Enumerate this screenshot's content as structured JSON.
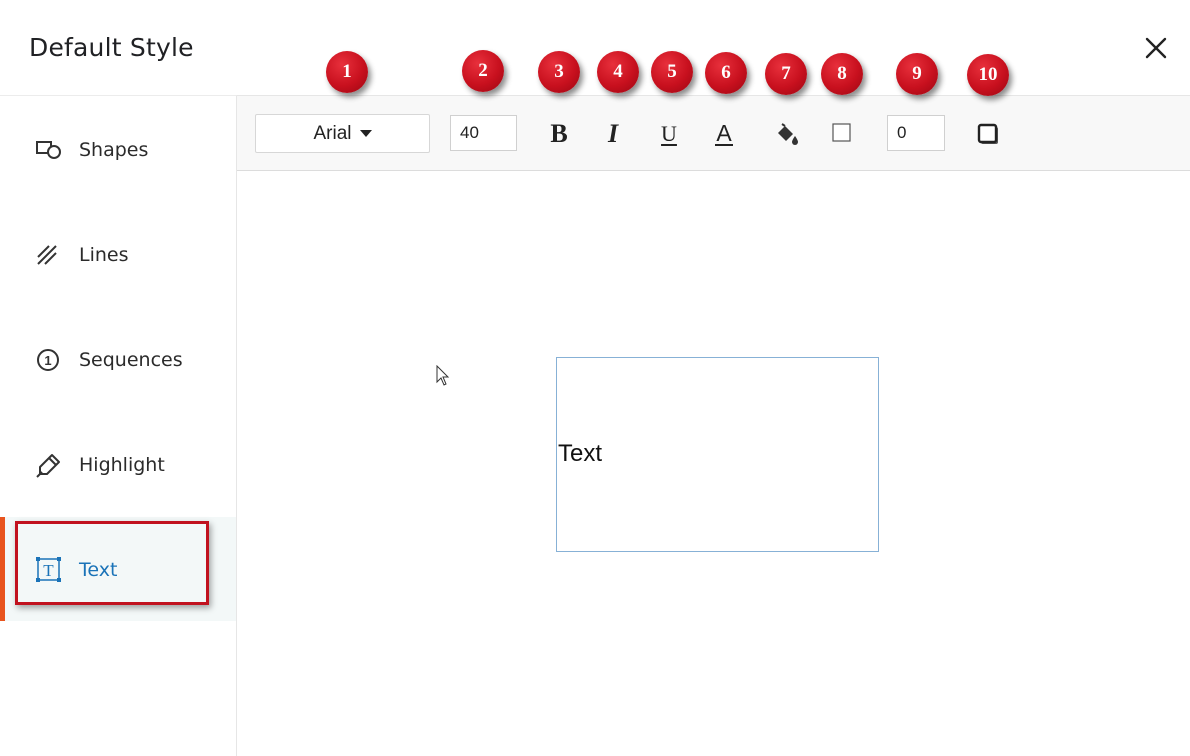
{
  "dialog": {
    "title": "Default Style",
    "close_icon": "close-icon"
  },
  "sidebar": {
    "items": [
      {
        "label": "Shapes",
        "icon": "shapes-icon",
        "active": false
      },
      {
        "label": "Lines",
        "icon": "lines-icon",
        "active": false
      },
      {
        "label": "Sequences",
        "icon": "sequence-number-icon",
        "active": false
      },
      {
        "label": "Highlight",
        "icon": "highlighter-icon",
        "active": false
      },
      {
        "label": "Text",
        "icon": "text-box-icon",
        "active": true
      }
    ]
  },
  "toolbar": {
    "font_family": "Arial",
    "font_size": "40",
    "bold_glyph": "B",
    "italic_glyph": "I",
    "underline_glyph": "U",
    "font_color_glyph": "A",
    "fill_icon": "paint-bucket-icon",
    "border_color_icon": "border-color-icon",
    "border_width": "0",
    "shadow_icon": "shadow-box-icon"
  },
  "annotations": {
    "badges": [
      "1",
      "2",
      "3",
      "4",
      "5",
      "6",
      "7",
      "8",
      "9",
      "10"
    ]
  },
  "canvas": {
    "sample_text": "Text"
  },
  "colors": {
    "accent": "#1a73b8",
    "active_bar": "#e8541e",
    "badge": "#c8101e",
    "highlight_border": "#c1121f"
  }
}
